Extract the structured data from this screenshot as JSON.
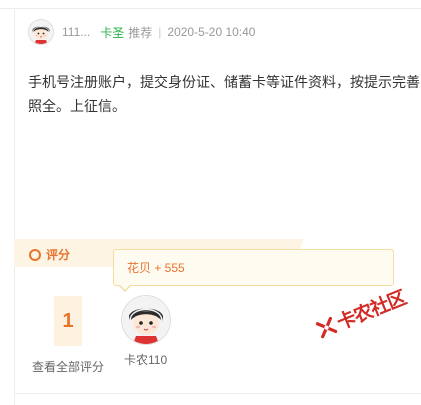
{
  "post": {
    "author_name": "111...",
    "tag": "卡圣",
    "recommend_label": "推荐",
    "separator": "|",
    "timestamp": "2020-5-20 10:40",
    "body_lines": [
      "手机号注册账户，提交身份证、储蓄卡等证件资料，按提示完善",
      "照全。上征信。"
    ]
  },
  "rating": {
    "section_title": "评分",
    "count": "1",
    "view_all_label": "查看全部评分",
    "tooltip_text": "花贝 + 555",
    "rater_name": "卡农110"
  },
  "watermark": {
    "text": "卡农社区"
  },
  "colors": {
    "accent": "#e8742c",
    "tag_green": "#2bb24c",
    "watermark_red": "#d22b25",
    "band": "#fdf4e4"
  },
  "icons": {
    "rating_ring": "ring-icon",
    "avatar": "cartoon-avatar-icon",
    "watermark_logo": "kanong-logo-icon"
  }
}
